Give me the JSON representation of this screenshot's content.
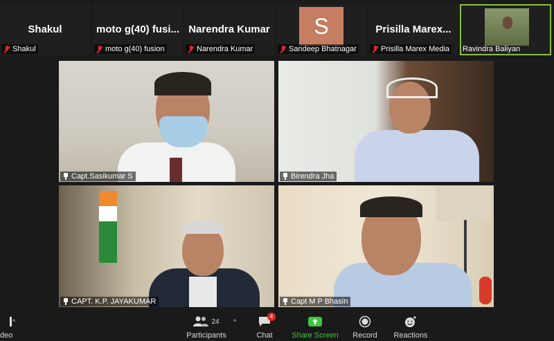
{
  "thumbnails": [
    {
      "big_name": "Shakul",
      "tag": "Shakul"
    },
    {
      "big_name": "moto g(40) fusi...",
      "tag": "moto g(40) fusion"
    },
    {
      "big_name": "Narendra Kumar",
      "tag": "Narendra Kumar"
    },
    {
      "avatar_letter": "S",
      "tag": "Sandeep Bhatnagar"
    },
    {
      "big_name": "Prisilla   Marex...",
      "tag": "Prisilla  Marex Media"
    },
    {
      "tag": "Ravindra Baliyan"
    }
  ],
  "tiles": [
    {
      "name": "Capt.Sasikumar S"
    },
    {
      "name": "Birendra Jha"
    },
    {
      "name": "CAPT. K.P. JAYAKUMAR"
    },
    {
      "name": "Capt M P Bhasin"
    }
  ],
  "toolbar": {
    "video_partial_label": "deo",
    "participants_label": "Participants",
    "participants_count": "24",
    "chat_label": "Chat",
    "chat_badge": "4",
    "share_label": "Share Screen",
    "record_label": "Record",
    "reactions_label": "Reactions"
  },
  "colors": {
    "share_green": "#3fc63f",
    "muted_red": "#e02828",
    "active_border": "#8cbf3a"
  }
}
